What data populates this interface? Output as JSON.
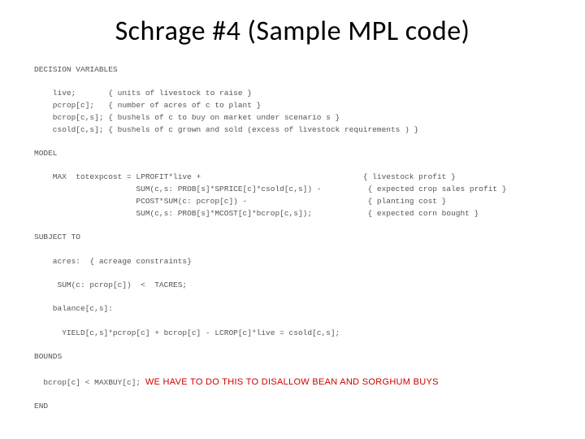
{
  "title": "Schrage #4 (Sample MPL code)",
  "code": {
    "l01": "DECISION VARIABLES",
    "l02": "",
    "l03": "    live;       { units of livestock to raise }",
    "l04": "    pcrop[c];   { number of acres of c to plant }",
    "l05": "    bcrop[c,s]; { bushels of c to buy on market under scenario s }",
    "l06": "    csold[c,s]; { bushels of c grown and sold (excess of livestock requirements ) }",
    "l07": "",
    "l08": "MODEL",
    "l09": "",
    "l10": "    MAX  totexpcost = LPROFIT*live +                                   { livestock profit }",
    "l11": "                      SUM(c,s: PROB[s]*SPRICE[c]*csold[c,s]) -          { expected crop sales profit }",
    "l12": "                      PCOST*SUM(c: pcrop[c]) -                          { planting cost }",
    "l13": "                      SUM(c,s: PROB[s]*MCOST[c]*bcrop[c,s]);            { expected corn bought }",
    "l14": "",
    "l15": "SUBJECT TO",
    "l16": "",
    "l17": "    acres:  { acreage constraints}",
    "l18": "",
    "l19": "     SUM(c: pcrop[c])  <  TACRES;",
    "l20": "",
    "l21": "    balance[c,s]:",
    "l22": "",
    "l23": "      YIELD[c,s]*pcrop[c] + bcrop[c] - LCROP[c]*live = csold[c,s];",
    "l24": "",
    "l25": "BOUNDS",
    "l26": "",
    "l27_code": "  bcrop[c] < MAXBUY[c]; ",
    "l27_annot": "WE HAVE TO DO THIS TO DISALLOW BEAN AND SORGHUM BUYS",
    "l28": "",
    "l29": "END"
  }
}
